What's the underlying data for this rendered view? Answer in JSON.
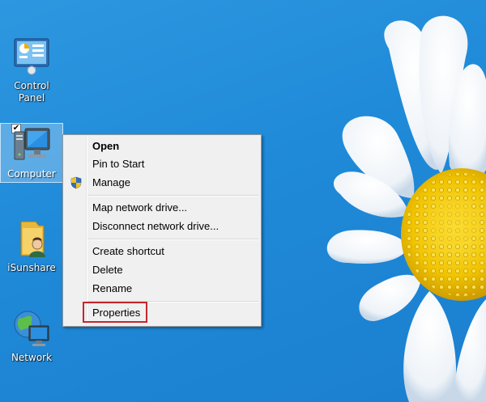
{
  "desktop": {
    "icons": [
      {
        "id": "control-panel",
        "label": "Control\nPanel"
      },
      {
        "id": "computer",
        "label": "Computer",
        "checked": true
      },
      {
        "id": "isunshare",
        "label": "iSunshare"
      },
      {
        "id": "network",
        "label": "Network"
      }
    ]
  },
  "context_menu": {
    "items": [
      {
        "label": "Open",
        "bold": true
      },
      {
        "label": "Pin to Start"
      },
      {
        "label": "Manage",
        "icon": "shield-icon"
      },
      {
        "label": "Map network drive..."
      },
      {
        "label": "Disconnect network drive..."
      },
      {
        "label": "Create shortcut"
      },
      {
        "label": "Delete"
      },
      {
        "label": "Rename"
      },
      {
        "label": "Properties",
        "highlighted": true
      }
    ]
  },
  "colors": {
    "desktop_bg": "#1f8ad8",
    "menu_bg": "#f0f0f0",
    "highlight_border": "#c4262e",
    "petal": "#ffffff",
    "flower_center": "#f2c200"
  }
}
